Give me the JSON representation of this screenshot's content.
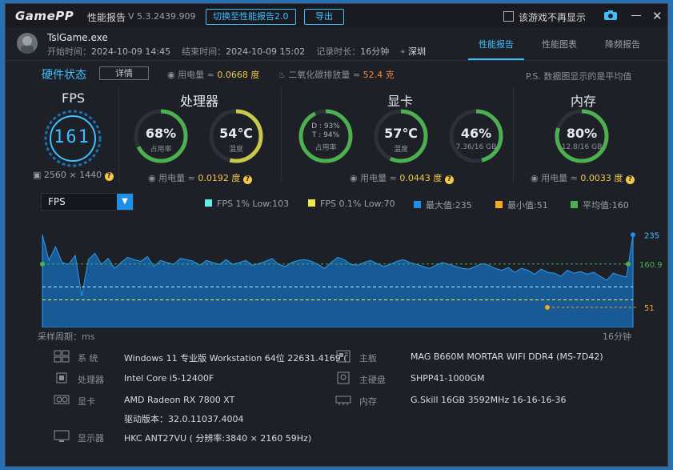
{
  "titlebar": {
    "logo": "GamePP",
    "title": "性能报告",
    "version": "V 5.3.2439.909",
    "switch_button": "切换至性能报告2.0",
    "export_button": "导出",
    "dont_show_label": "该游戏不再显示"
  },
  "app": {
    "name": "TslGame.exe",
    "start_label": "开始时间：",
    "start_value": "2024-10-09 14:45",
    "end_label": "结束时间：",
    "end_value": "2024-10-09 15:02",
    "duration_label": "记录时长：",
    "duration_value": "16分钟",
    "city": "深圳"
  },
  "tabs": [
    "性能报告",
    "性能图表",
    "降频报告"
  ],
  "hardware": {
    "title": "硬件状态",
    "detail_button": "详情",
    "power_label": "用电量 ≈ ",
    "power_value": "0.0668 度",
    "co2_label": "二氧化碳排放量 ≈ ",
    "co2_value": "52.4 克",
    "ps_note": "P.S. 数据图显示的是平均值"
  },
  "sections": {
    "fps": {
      "title": "FPS",
      "value": "161",
      "resolution": "2560 × 1440"
    },
    "cpu": {
      "title": "处理器",
      "usage_value": "68%",
      "usage_label": "占用率",
      "temp_value": "54℃",
      "temp_label": "温度",
      "power_label": "用电量 ≈ ",
      "power_value": "0.0192 度"
    },
    "gpu": {
      "title": "显卡",
      "dt_line1": "D : 93%",
      "dt_line2": "T : 94%",
      "usage_label": "占用率",
      "temp_value": "57℃",
      "temp_label": "温度",
      "vram_value": "46%",
      "vram_label": "7.36/16 GB",
      "power_label": "用电量 ≈ ",
      "power_value": "0.0443 度"
    },
    "mem": {
      "title": "内存",
      "usage_value": "80%",
      "usage_label": "12.8/16 GB",
      "power_label": "用电量 ≈ ",
      "power_value": "0.0033 度"
    }
  },
  "chart_controls": {
    "metric_select": "FPS",
    "legend": [
      {
        "label": "FPS 1% Low:103",
        "color": "#5ff0e8"
      },
      {
        "label": "FPS 0.1% Low:70",
        "color": "#f0e84a"
      },
      {
        "label": "最大值:235",
        "color": "#1e8ee8"
      },
      {
        "label": "最小值:51",
        "color": "#f5a623"
      },
      {
        "label": "平均值:160",
        "color": "#4caf50"
      }
    ],
    "footer_left": "采样周期：ms",
    "footer_right": "16分钟"
  },
  "chart_data": {
    "type": "area",
    "ylim": [
      0,
      260
    ],
    "max": 235,
    "min": 51,
    "avg": 160.9,
    "low_1pct": 103,
    "low_01pct": 70,
    "annotations": [
      "235",
      "160.9",
      "51"
    ],
    "series": [
      {
        "values": [
          235,
          170,
          205,
          165,
          160,
          183,
          80,
          172,
          188,
          160,
          175,
          150,
          165,
          178,
          172,
          168,
          180,
          155,
          170,
          165,
          160,
          175,
          172,
          168,
          158,
          170,
          165,
          160,
          172,
          160,
          165,
          170,
          158,
          162,
          168,
          175,
          160,
          155,
          165,
          170,
          172,
          168,
          160,
          150,
          165,
          178,
          172,
          160,
          158,
          165,
          170,
          162,
          155,
          160,
          168,
          172,
          165,
          160,
          155,
          150,
          158,
          165,
          160,
          155,
          150,
          148,
          155,
          162,
          158,
          150,
          145,
          152,
          140,
          150,
          145,
          135,
          148,
          140,
          138,
          130,
          145,
          138,
          142,
          135,
          140,
          130,
          120,
          138,
          132,
          128,
          235
        ]
      }
    ]
  },
  "specs": [
    {
      "key": "系  统",
      "value": "Windows 11 专业版 Workstation 64位 22631.4169 ("
    },
    {
      "key": "处理器",
      "value": "Intel Core i5-12400F"
    },
    {
      "key": "显卡",
      "value": "AMD Radeon RX 7800 XT",
      "value2": "驱动版本：32.0.11037.4004"
    },
    {
      "key": "显示器",
      "value": "HKC ANT27VU ( 分辨率:3840 × 2160 59Hz)"
    },
    {
      "key": "主板",
      "value": "MAG B660M MORTAR WIFI DDR4 (MS-7D42)"
    },
    {
      "key": "主硬盘",
      "value": "SHPP41-1000GM"
    },
    {
      "key": "内存",
      "value": "G.Skill 16GB 3592MHz 16-16-16-36"
    }
  ],
  "colors": {
    "accent": "#3ec0ff",
    "ring_green": "#4caf50",
    "ring_yellow": "#c8c84a"
  }
}
